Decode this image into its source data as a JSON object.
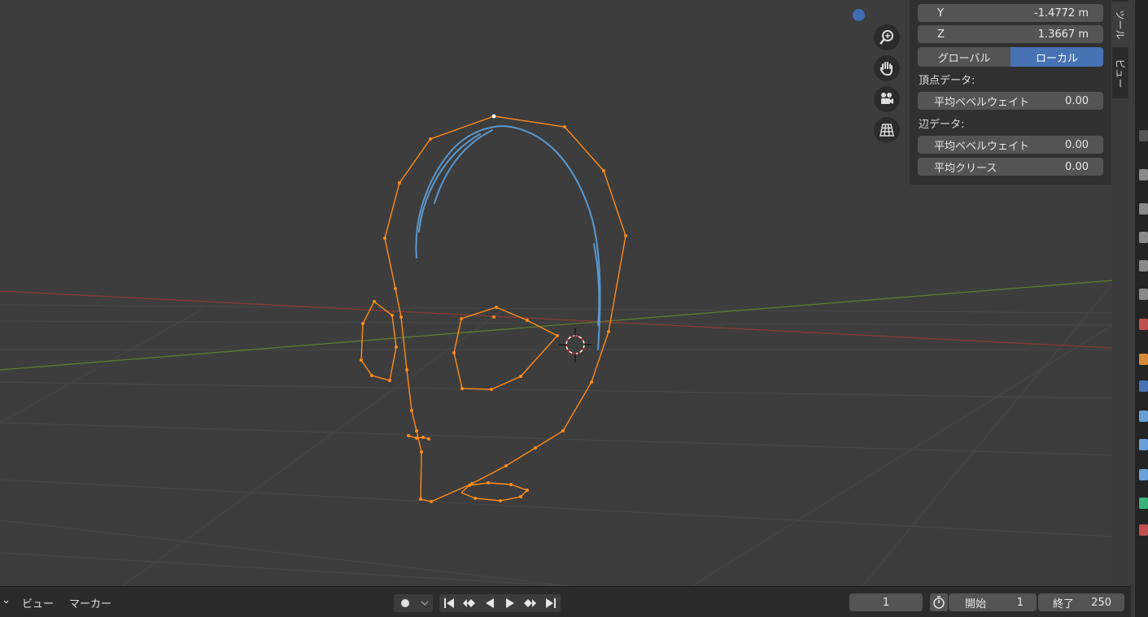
{
  "transform": {
    "y_label": "Y",
    "y_value": "-1.4772 m",
    "z_label": "Z",
    "z_value": "1.3667 m",
    "global_label": "グローバル",
    "local_label": "ローカル"
  },
  "vertex_data": {
    "heading": "頂点データ:",
    "bevel_label": "平均ベベルウェイト",
    "bevel_value": "0.00"
  },
  "edge_data": {
    "heading": "辺データ:",
    "bevel_label": "平均ベベルウェイト",
    "bevel_value": "0.00",
    "crease_label": "平均クリース",
    "crease_value": "0.00"
  },
  "tabs": {
    "tool": "ツール",
    "view": "ビュー"
  },
  "timeline": {
    "view_menu": "ビュー",
    "marker_menu": "マーカー",
    "current_frame": "1",
    "start_label": "開始",
    "start_value": "1",
    "end_label": "終了",
    "end_value": "250"
  },
  "colors": {
    "accent": "#4772b3",
    "selected_stroke": "#ff8c1a",
    "stroke_blue": "#5b98cf",
    "x_axis": "#8a3a3a",
    "y_axis": "#5f7a2e"
  }
}
